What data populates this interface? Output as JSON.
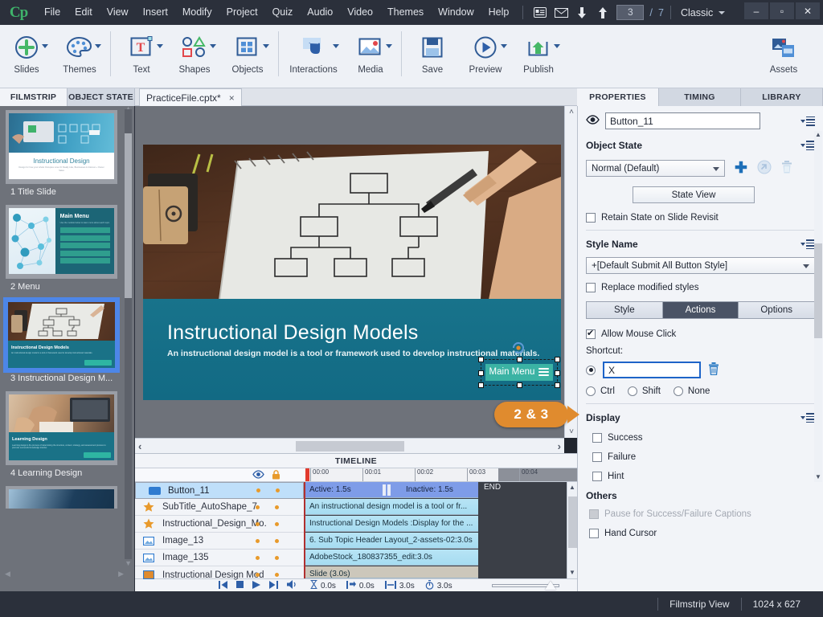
{
  "menubar": {
    "logo": "Cp",
    "items": [
      "File",
      "Edit",
      "View",
      "Insert",
      "Modify",
      "Project",
      "Quiz",
      "Audio",
      "Video",
      "Themes",
      "Window",
      "Help"
    ],
    "icons": [
      "slide-notes-icon",
      "mail-icon",
      "move-down-icon",
      "move-up-icon"
    ],
    "slide_current": "3",
    "slide_sep": "/",
    "slide_total": "7",
    "workspace": "Classic",
    "window_controls": {
      "minimize": "–",
      "maximize": "▫",
      "close": "✕"
    }
  },
  "ribbon": {
    "buttons": [
      {
        "label": "Slides",
        "icon": "plus-circle-icon",
        "caret": true
      },
      {
        "label": "Themes",
        "icon": "palette-icon",
        "caret": true
      },
      {
        "label": "Text",
        "icon": "text-box-icon",
        "caret": true
      },
      {
        "label": "Shapes",
        "icon": "shapes-icon",
        "caret": true
      },
      {
        "label": "Objects",
        "icon": "grid-objects-icon",
        "caret": true
      },
      {
        "label": "Interactions",
        "icon": "hand-click-icon",
        "caret": true
      },
      {
        "label": "Media",
        "icon": "image-media-icon",
        "caret": true
      },
      {
        "label": "Save",
        "icon": "floppy-disk-icon",
        "caret": false
      },
      {
        "label": "Preview",
        "icon": "play-circle-icon",
        "caret": true
      },
      {
        "label": "Publish",
        "icon": "upload-box-icon",
        "caret": true
      },
      {
        "label": "Assets",
        "icon": "assets-icon",
        "caret": false
      }
    ]
  },
  "left_panel": {
    "tabs": [
      {
        "label": "FILMSTRIP",
        "active": true
      },
      {
        "label": "OBJECT STATE",
        "active": false
      }
    ],
    "slides": [
      {
        "label": "1 Title Slide",
        "title": "Instructional Design",
        "subtitle": "Design for how your whole Occupies Love Or Really Like, Businesses & Interest + Owner Sales",
        "selected": false,
        "kind": "title"
      },
      {
        "label": "2 Menu",
        "title": "Main Menu",
        "subtitle": "Use the module below to learn more about each topic.",
        "selected": false,
        "kind": "menu"
      },
      {
        "label": "3 Instructional Design M...",
        "title": "Instructional Design Models",
        "subtitle": "An instructional design model is a tool or framework used to develop instructional materials.",
        "selected": true,
        "kind": "models"
      },
      {
        "label": "4 Learning Design",
        "title": "Learning Design",
        "subtitle": "Learning design is the process of determining the structure, content, strategy, and assessment process to promote successful knowledge transfer.",
        "selected": false,
        "kind": "learning"
      },
      {
        "label": "",
        "title": "",
        "subtitle": "",
        "selected": false,
        "kind": "partial"
      }
    ]
  },
  "document": {
    "tab_label": "PracticeFile.cptx*",
    "close_glyph": "×"
  },
  "stage": {
    "title": "Instructional Design Models",
    "subtitle": "An instructional design model is a tool or framework used to develop instructional materials.",
    "button_label": "Main Menu",
    "scroll_left_glyph": "‹",
    "scroll_right_glyph": "›",
    "scroll_up_glyph": "˄",
    "scroll_down_glyph": "˅"
  },
  "callout": {
    "text": "2 & 3",
    "color": "#e08b2e"
  },
  "timeline": {
    "title": "TIMELINE",
    "header_icons": [
      "eye-icon",
      "lock-icon"
    ],
    "ruler_labels": [
      "00:00",
      "00:01",
      "00:02",
      "00:03",
      "00:04"
    ],
    "end_label": "END",
    "rows": [
      {
        "name": "Button_11",
        "icon": "button-icon",
        "selected": true,
        "bar_left": "Active: 1.5s",
        "bar_right": "Inactive: 1.5s",
        "type": "button"
      },
      {
        "name": "SubTitle_AutoShape_7",
        "icon": "star-icon",
        "selected": false,
        "bar_left": "An instructional design model is a tool or fr...",
        "type": "shape"
      },
      {
        "name": "Instructional_Design_Mo.",
        "icon": "star-icon",
        "selected": false,
        "bar_left": "Instructional Design Models :Display for the ...",
        "type": "shape"
      },
      {
        "name": "Image_13",
        "icon": "image-icon",
        "selected": false,
        "bar_left": "6. Sub Topic Header Layout_2-assets-02:3.0s",
        "type": "image"
      },
      {
        "name": "Image_135",
        "icon": "image-icon",
        "selected": false,
        "bar_left": "AdobeStock_180837355_edit:3.0s",
        "type": "image"
      },
      {
        "name": "Instructional Design Mod",
        "icon": "slide-icon",
        "selected": false,
        "bar_left": "Slide (3.0s)",
        "type": "slide"
      }
    ],
    "footer": {
      "controls": [
        "rewind-icon",
        "stop-icon",
        "play-icon",
        "forward-icon",
        "audio-icon"
      ],
      "times": [
        {
          "icon": "hourglass-icon",
          "value": "0.0s"
        },
        {
          "icon": "start-time-icon",
          "value": "0.0s"
        },
        {
          "icon": "duration-icon",
          "value": "3.0s"
        },
        {
          "icon": "stopwatch-icon",
          "value": "3.0s"
        }
      ]
    }
  },
  "properties": {
    "tabs": [
      {
        "label": "PROPERTIES",
        "active": true
      },
      {
        "label": "TIMING",
        "active": false
      },
      {
        "label": "LIBRARY",
        "active": false
      }
    ],
    "object_name": "Button_11",
    "object_state_title": "Object State",
    "state_value": "Normal (Default)",
    "state_view_label": "State View",
    "retain_state_label": "Retain State on Slide Revisit",
    "retain_state_checked": false,
    "style_name_title": "Style Name",
    "style_value": "+[Default Submit All Button Style]",
    "replace_styles_label": "Replace modified styles",
    "replace_styles_checked": false,
    "segments": [
      {
        "label": "Style",
        "active": false
      },
      {
        "label": "Actions",
        "active": true
      },
      {
        "label": "Options",
        "active": false
      }
    ],
    "allow_mouse_click_label": "Allow Mouse Click",
    "allow_mouse_click_checked": true,
    "shortcut_label": "Shortcut:",
    "shortcut_value": "X",
    "shortcut_radios": [
      {
        "label": "",
        "selected": true
      },
      {
        "label": "Ctrl",
        "selected": false
      },
      {
        "label": "Shift",
        "selected": false
      },
      {
        "label": "None",
        "selected": false
      }
    ],
    "display_title": "Display",
    "display_items": [
      {
        "label": "Success",
        "checked": false,
        "disabled": false
      },
      {
        "label": "Failure",
        "checked": false,
        "disabled": false
      },
      {
        "label": "Hint",
        "checked": false,
        "disabled": false
      }
    ],
    "others_title": "Others",
    "others_items": [
      {
        "label": "Pause for Success/Failure Captions",
        "checked": false,
        "disabled": true
      },
      {
        "label": "Hand Cursor",
        "checked": false,
        "disabled": false
      }
    ],
    "icons": [
      "eye-icon",
      "add-state-icon",
      "reset-state-icon",
      "delete-state-icon",
      "trash-icon",
      "panel-menu-icon"
    ]
  },
  "statusbar": {
    "view_mode": "Filmstrip View",
    "dimensions": "1024 x 627"
  }
}
